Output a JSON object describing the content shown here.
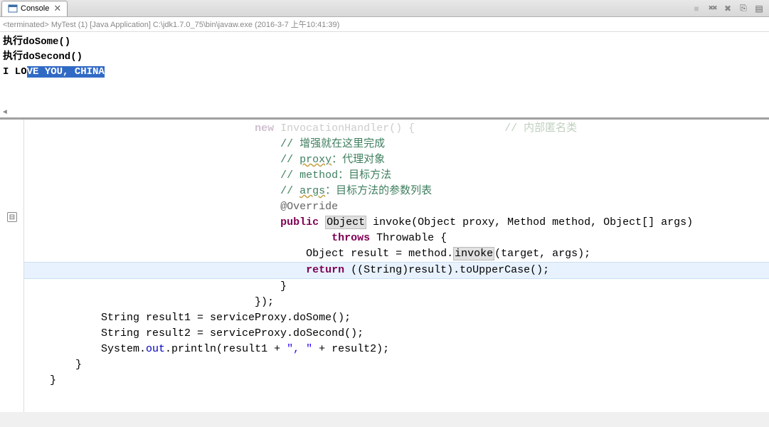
{
  "tab": {
    "label": "Console",
    "close_glyph": "✕"
  },
  "toolbar": {
    "terminate": "■",
    "remove_all": "✖✖",
    "remove": "✖",
    "pin": "⎘",
    "open": "▤"
  },
  "status": "<terminated> MyTest (1) [Java Application] C:\\jdk1.7.0_75\\bin\\javaw.exe (2016-3-7 上午10:41:39)",
  "output": {
    "line1": "执行doSome()",
    "line2": "执行doSecond()",
    "line3_prefix": "I LO",
    "line3_selected": "VE YOU, CHINA"
  },
  "code": {
    "l0a": "                                    ",
    "l0_kw": "new",
    "l0b": " InvocationHandler() {              ",
    "l0c": "// 内部匿名类",
    "l1": "",
    "l2_indent": "                                        ",
    "l2_c": "// 增强就在这里完成",
    "l3_c": "// ",
    "l3_sq": "proxy",
    "l3_c2": "：代理对象",
    "l4_c": "// method：目标方法",
    "l5_c": "// ",
    "l5_sq": "args",
    "l5_c2": "：目标方法的参数列表",
    "l6_ann": "@Override",
    "l7_kw1": "public",
    "l7_sp": " ",
    "l7_obj": "Object",
    "l7_rest": " invoke(Object proxy, Method method, Object[] args)",
    "l8_indent": "                                                ",
    "l8_kw": "throws",
    "l8_rest": " Throwable {",
    "l9_indent": "                                            ",
    "l9_a": "Object result = method.",
    "l9_box": "invoke",
    "l9_b": "(target, args);",
    "l10_indent": "                                            ",
    "l10_kw": "return",
    "l10_rest": " ((String)result).toUpperCase();",
    "l11": "                                        }",
    "l12": "                                    });",
    "l13a": "            String result1 = serviceProxy.doSome();",
    "l14a": "            String result2 = serviceProxy.doSecond();",
    "l15a": "            System.",
    "l15_field": "out",
    "l15b": ".println(result1 + ",
    "l15_str": "\", \"",
    "l15c": " + result2);",
    "l16": "        }",
    "l17": "",
    "l18": "    }"
  },
  "gutter": {
    "collapse": "⊟"
  }
}
